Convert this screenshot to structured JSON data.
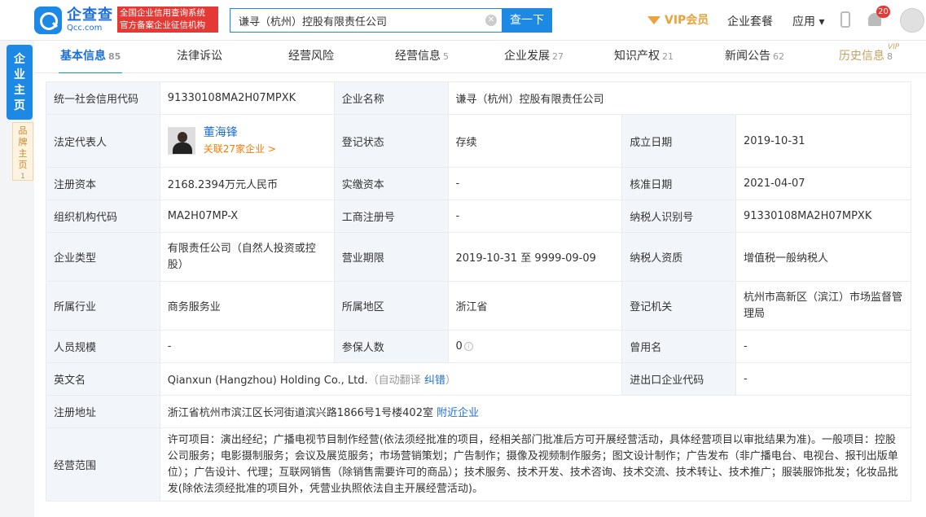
{
  "header": {
    "logo_cn": "企查查",
    "logo_en": "Qcc.com",
    "slogan_line1": "全国企业信用查询系统",
    "slogan_line2": "官方备案企业征信机构",
    "search_value": "谦寻（杭州）控股有限责任公司",
    "search_button": "查一下",
    "vip_label": "VIP会员",
    "package_label": "企业套餐",
    "apps_label": "应用 ▾",
    "notification_count": "20"
  },
  "side": {
    "main_tab": "企业主页",
    "brand_tab": "品牌主页",
    "brand_count": "1"
  },
  "tabs": [
    {
      "label": "基本信息",
      "count": "85"
    },
    {
      "label": "法律诉讼",
      "count": ""
    },
    {
      "label": "经营风险",
      "count": ""
    },
    {
      "label": "经营信息",
      "count": "5"
    },
    {
      "label": "企业发展",
      "count": "27"
    },
    {
      "label": "知识产权",
      "count": "21"
    },
    {
      "label": "新闻公告",
      "count": "62"
    },
    {
      "label": "历史信息",
      "count": "8"
    }
  ],
  "vip_tag": "VIP",
  "info": {
    "credit_code_label": "统一社会信用代码",
    "credit_code": "91330108MA2H07MPXK",
    "company_name_label": "企业名称",
    "company_name": "谦寻（杭州）控股有限责任公司",
    "legal_rep_label": "法定代表人",
    "legal_rep_name": "董海锋",
    "legal_rep_assoc": "关联27家企业 >",
    "reg_status_label": "登记状态",
    "reg_status": "存续",
    "found_date_label": "成立日期",
    "found_date": "2019-10-31",
    "reg_capital_label": "注册资本",
    "reg_capital": "2168.2394万元人民币",
    "paid_capital_label": "实缴资本",
    "paid_capital": "-",
    "approve_date_label": "核准日期",
    "approve_date": "2021-04-07",
    "org_code_label": "组织机构代码",
    "org_code": "MA2H07MP-X",
    "biz_reg_no_label": "工商注册号",
    "biz_reg_no": "-",
    "taxpayer_id_label": "纳税人识别号",
    "taxpayer_id": "91330108MA2H07MPXK",
    "company_type_label": "企业类型",
    "company_type": "有限责任公司（自然人投资或控股）",
    "biz_term_label": "营业期限",
    "biz_term": "2019-10-31 至 9999-09-09",
    "taxpayer_qual_label": "纳税人资质",
    "taxpayer_qual": "增值税一般纳税人",
    "industry_label": "所属行业",
    "industry": "商务服务业",
    "region_label": "所属地区",
    "region": "浙江省",
    "reg_authority_label": "登记机关",
    "reg_authority": "杭州市高新区（滨江）市场监督管理局",
    "staff_size_label": "人员规模",
    "staff_size": "-",
    "insured_label": "参保人数",
    "insured": "0",
    "former_name_label": "曾用名",
    "former_name": "-",
    "english_name_label": "英文名",
    "english_name": "Qianxun (Hangzhou) Holding Co., Ltd.",
    "auto_translate": "（自动翻译",
    "correct_link": "纠错",
    "auto_translate_end": "）",
    "import_export_label": "进出口企业代码",
    "import_export": "-",
    "address_label": "注册地址",
    "address": "浙江省杭州市滨江区长河街道滨兴路1866号1号楼402室",
    "nearby_link": "附近企业",
    "scope_label": "经营范围",
    "scope": "许可项目：演出经纪；广播电视节目制作经营(依法须经批准的项目，经相关部门批准后方可开展经营活动，具体经营项目以审批结果为准)。一般项目：控股公司服务；电影摄制服务；会议及展览服务；市场营销策划；广告制作；摄像及视频制作服务；图文设计制作；广告发布（非广播电台、电视台、报刊出版单位）；广告设计、代理；互联网销售（除销售需要许可的商品）；技术服务、技术开发、技术咨询、技术交流、技术转让、技术推广；服装服饰批发；化妆品批发(除依法须经批准的项目外，凭营业执照依法自主开展经营活动)。"
  }
}
